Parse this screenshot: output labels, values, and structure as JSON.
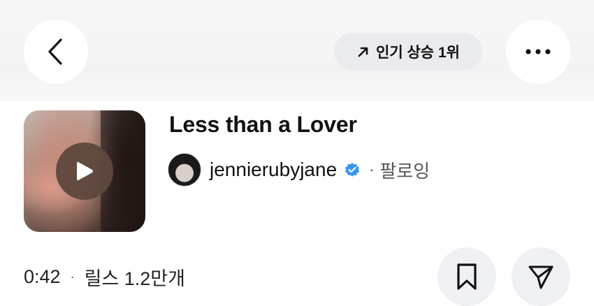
{
  "header": {
    "trend_badge": "인기 상승 1위"
  },
  "song": {
    "title": "Less than a Lover",
    "artist": "jennierubyjane",
    "separator": "·",
    "follow_label": "팔로잉"
  },
  "meta": {
    "duration": "0:42",
    "separator": "·",
    "reels_count": "릴스 1.2만개"
  },
  "icons": {
    "back": "chevron-left-icon",
    "trend": "arrow-up-right-icon",
    "more": "more-horizontal-icon",
    "play": "play-icon",
    "verified": "verified-badge-icon",
    "save": "bookmark-icon",
    "share": "send-icon"
  },
  "colors": {
    "verified": "#3897f0",
    "pill_bg": "#e9ebee",
    "button_bg": "#eef0f3"
  }
}
